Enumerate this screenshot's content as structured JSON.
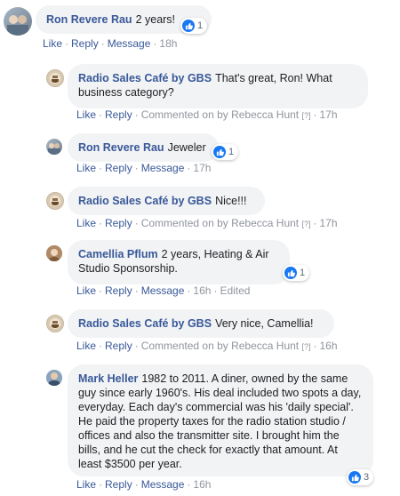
{
  "comments": [
    {
      "author": "Ron Revere Rau",
      "text": "2 years!",
      "reactions": "1",
      "actions": {
        "like": "Like",
        "reply": "Reply",
        "message": "Message",
        "time": "18h"
      }
    },
    {
      "author": "Radio Sales Café by GBS",
      "text": "That's great, Ron! What business category?",
      "actions": {
        "like": "Like",
        "reply": "Reply",
        "commented_on": "Commented on by Rebecca Hunt",
        "hint": "[?]",
        "time": "17h"
      }
    },
    {
      "author": "Ron Revere Rau",
      "text": "Jeweler",
      "reactions": "1",
      "actions": {
        "like": "Like",
        "reply": "Reply",
        "message": "Message",
        "time": "17h"
      }
    },
    {
      "author": "Radio Sales Café by GBS",
      "text": "Nice!!!",
      "actions": {
        "like": "Like",
        "reply": "Reply",
        "commented_on": "Commented on by Rebecca Hunt",
        "hint": "[?]",
        "time": "17h"
      }
    },
    {
      "author": "Camellia Pflum",
      "text": "2 years, Heating & Air Studio Sponsorship.",
      "reactions": "1",
      "actions": {
        "like": "Like",
        "reply": "Reply",
        "message": "Message",
        "time": "16h",
        "edited": "Edited"
      }
    },
    {
      "author": "Radio Sales Café by GBS",
      "text": "Very nice, Camellia!",
      "actions": {
        "like": "Like",
        "reply": "Reply",
        "commented_on": "Commented on by Rebecca Hunt",
        "hint": "[?]",
        "time": "16h"
      }
    },
    {
      "author": "Mark Heller",
      "text": "1982 to 2011. A diner, owned by the same guy since early 1960's. His deal included two spots a day, everyday. Each day's commercial was his 'daily special'. He paid the property taxes for the radio station studio / offices and also the transmitter site. I brought him the bills, and he cut the check for exactly that amount. At least $3500 per year.",
      "reactions": "3",
      "actions": {
        "like": "Like",
        "reply": "Reply",
        "message": "Message",
        "time": "16h"
      }
    }
  ],
  "colors": {
    "link": "#385898",
    "meta": "#90949c",
    "bubble": "#f2f3f5",
    "like_blue": "#1877f2"
  }
}
